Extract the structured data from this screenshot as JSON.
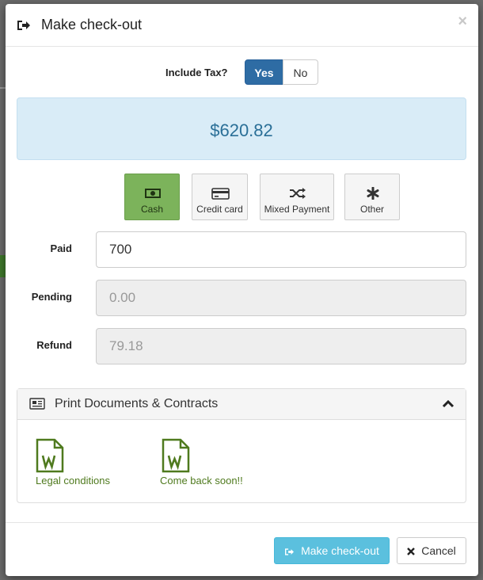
{
  "modal": {
    "title": "Make check-out",
    "close": "×"
  },
  "tax": {
    "label": "Include Tax?",
    "yes": "Yes",
    "no": "No",
    "selected": "Yes"
  },
  "total": "$620.82",
  "payment_methods": [
    {
      "label": "Cash",
      "icon": "cash-icon",
      "active": true
    },
    {
      "label": "Credit card",
      "icon": "credit-card-icon",
      "active": false
    },
    {
      "label": "Mixed Payment",
      "icon": "shuffle-icon",
      "active": false
    },
    {
      "label": "Other",
      "icon": "asterisk-icon",
      "active": false
    }
  ],
  "fields": {
    "paid": {
      "label": "Paid",
      "value": "700"
    },
    "pending": {
      "label": "Pending",
      "value": "0.00"
    },
    "refund": {
      "label": "Refund",
      "value": "79.18"
    }
  },
  "documents": {
    "title": "Print Documents & Contracts",
    "items": [
      {
        "label": "Legal conditions",
        "icon": "word-document-icon"
      },
      {
        "label": "Come back soon!!",
        "icon": "word-document-icon"
      }
    ]
  },
  "footer": {
    "checkout": "Make check-out",
    "cancel": "Cancel"
  },
  "colors": {
    "primary": "#2e6ca4",
    "active_payment": "#7cb35b",
    "total_bg": "#d9ecf7",
    "checkout_btn": "#5bc0de",
    "doc_green": "#4f7a1e"
  }
}
